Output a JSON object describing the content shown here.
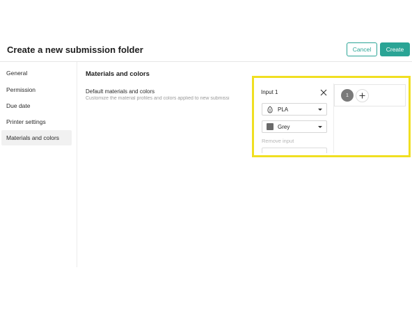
{
  "header": {
    "title": "Create a new submission folder",
    "cancel_label": "Cancel",
    "create_label": "Create"
  },
  "sidebar": {
    "items": [
      {
        "label": "General"
      },
      {
        "label": "Permission"
      },
      {
        "label": "Due date"
      },
      {
        "label": "Printer settings"
      },
      {
        "label": "Materials and colors",
        "active": true
      }
    ]
  },
  "main": {
    "section_title": "Materials and colors",
    "setting_label": "Default materials and colors",
    "setting_description": "Customize the material profiles and colors applied to new submissi"
  },
  "input_panel": {
    "title": "Input 1",
    "material": {
      "label": "PLA",
      "icon": "spool-icon"
    },
    "color": {
      "label": "Grey",
      "swatch": "#6a6a6a"
    },
    "remove_label": "Remove input"
  },
  "inputs": {
    "number": "1"
  },
  "colors": {
    "accent": "#2aa495",
    "highlight": "#f0df21"
  }
}
